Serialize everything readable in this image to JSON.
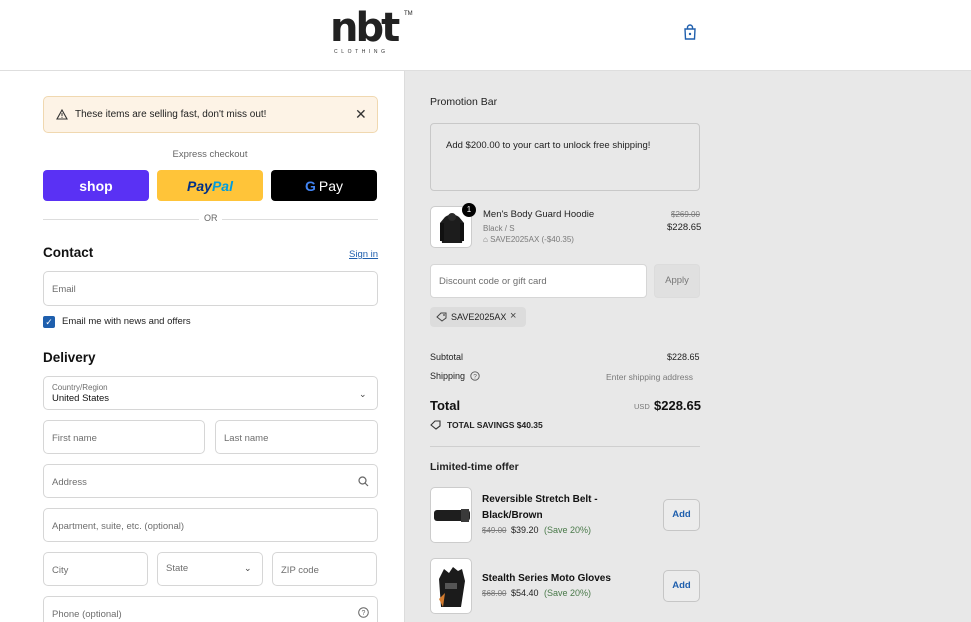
{
  "header": {
    "logo": {
      "main": "nbt",
      "tm": "TM",
      "sub": "CLOTHING"
    },
    "cart_icon": "shopping-bag-icon"
  },
  "alert": {
    "text": "These items are selling fast, don't miss out!",
    "icon": "warning-icon",
    "close": "✕"
  },
  "express": {
    "label": "Express checkout",
    "shop_label": "shop",
    "paypal_label_1": "Pay",
    "paypal_label_2": "Pal",
    "gpay_g": "G",
    "gpay_label": "Pay",
    "or": "OR"
  },
  "contact": {
    "title": "Contact",
    "signin": "Sign in",
    "email_placeholder": "Email",
    "newsletter_label": "Email me with news and offers",
    "newsletter_checked": true
  },
  "delivery": {
    "title": "Delivery",
    "country_label": "Country/Region",
    "country_value": "United States",
    "first_name": "First name",
    "last_name": "Last name",
    "address": "Address",
    "apartment": "Apartment, suite, etc. (optional)",
    "city": "City",
    "state": "State",
    "zip": "ZIP code",
    "phone": "Phone (optional)"
  },
  "summary": {
    "promo_title": "Promotion Bar",
    "promo_text": "Add $200.00 to your cart to unlock free shipping!",
    "item": {
      "qty": "1",
      "name": "Men's Body Guard Hoodie",
      "variant": "Black / S",
      "discount": "SAVE2025AX (-$40.35)",
      "original_price": "$269.00",
      "price": "$228.65"
    },
    "discount_placeholder": "Discount code or gift card",
    "apply": "Apply",
    "applied_code": "SAVE2025AX",
    "subtotal_label": "Subtotal",
    "subtotal_value": "$228.65",
    "shipping_label": "Shipping",
    "shipping_value": "Enter shipping address",
    "total_label": "Total",
    "currency": "USD",
    "total_value": "$228.65",
    "savings": "TOTAL SAVINGS  $40.35"
  },
  "offers": {
    "title": "Limited-time offer",
    "items": [
      {
        "name_1": "Reversible Stretch Belt -",
        "name_2": "Black/Brown",
        "old": "$49.00",
        "new": "$39.20",
        "save": "(Save 20%)",
        "add": "Add"
      },
      {
        "name_1": "Stealth Series Moto Gloves",
        "old": "$68.00",
        "new": "$54.40",
        "save": "(Save 20%)",
        "add": "Add"
      }
    ]
  },
  "colors": {
    "accent": "#1f5fad",
    "shop": "#5a31f4",
    "paypal": "#ffc439",
    "summary_bg": "#e8e8e8"
  }
}
